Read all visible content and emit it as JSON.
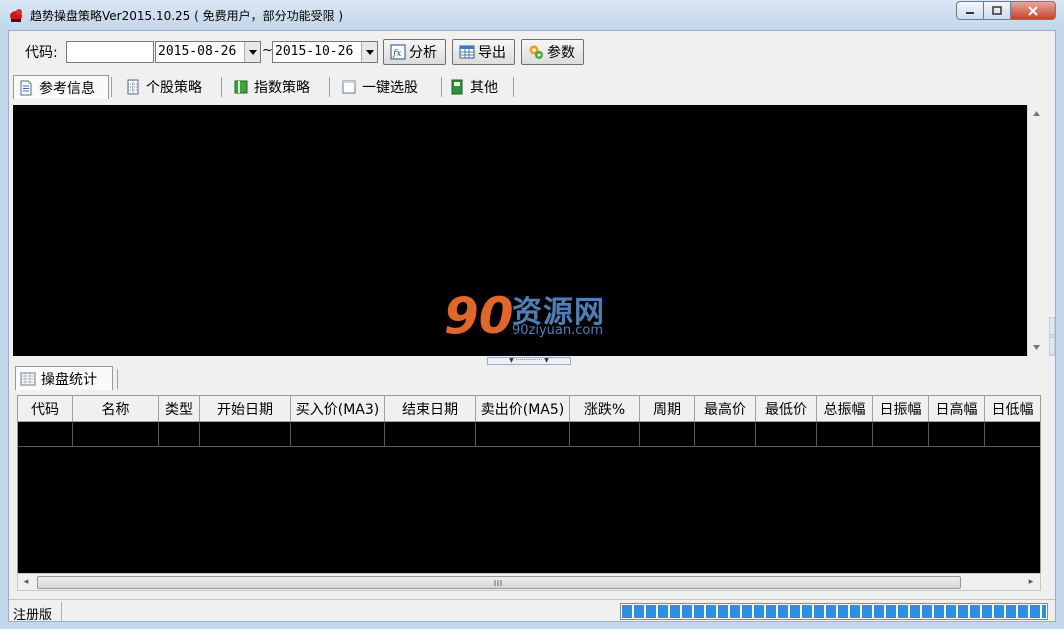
{
  "window": {
    "title": "趋势操盘策略Ver2015.10.25 ( 免费用户，部分功能受限 )"
  },
  "toolbar": {
    "code_label": "代码:",
    "code_value": "",
    "start_date": "2015-08-26",
    "date_separator": "~",
    "end_date": "2015-10-26",
    "analyze_label": "分析",
    "export_label": "导出",
    "params_label": "参数"
  },
  "tabs": [
    {
      "label": "参考信息",
      "icon": "document-icon",
      "active": true
    },
    {
      "label": "个股策略",
      "icon": "grid-icon",
      "active": false
    },
    {
      "label": "指数策略",
      "icon": "book-icon",
      "active": false
    },
    {
      "label": "一键选股",
      "icon": "window-icon",
      "active": false
    },
    {
      "label": "其他",
      "icon": "notebook-icon",
      "active": false
    }
  ],
  "watermark": {
    "logo": "90",
    "name": "资源网",
    "url": "90ziyuan.com"
  },
  "stats_tab": {
    "label": "操盘统计"
  },
  "grid": {
    "columns": [
      "代码",
      "名称",
      "类型",
      "开始日期",
      "买入价(MA3)",
      "结束日期",
      "卖出价(MA5)",
      "涨跌%",
      "周期",
      "最高价",
      "最低价",
      "总振幅",
      "日振幅",
      "日高幅",
      "日低幅"
    ]
  },
  "status": {
    "text": "注册版",
    "progress": 1.0
  },
  "colors": {
    "panel_bg": "#000000",
    "progress": "#2d8fe3",
    "close_button": "#c7422c"
  }
}
